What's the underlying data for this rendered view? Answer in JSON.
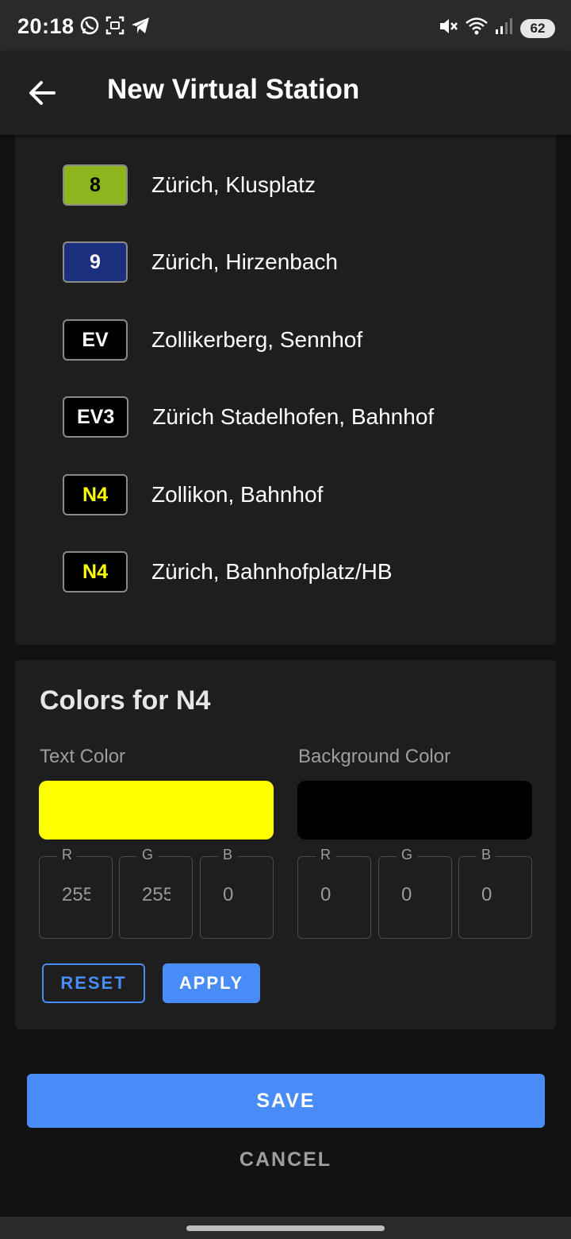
{
  "status_bar": {
    "time": "20:18",
    "battery": "62",
    "left_icons": [
      "whatsapp-icon",
      "screenshot-icon",
      "telegram-icon"
    ],
    "right_icons": [
      "mute-icon",
      "wifi-icon",
      "signal-icon",
      "battery-icon"
    ]
  },
  "app_bar": {
    "title": "New Virtual Station",
    "back_icon": "arrow-left-icon"
  },
  "stations": [
    {
      "line": "8",
      "name": "Zürich, Klusplatz",
      "text_color": "#000000",
      "bg_color": "#8db51e"
    },
    {
      "line": "9",
      "name": "Zürich, Hirzenbach",
      "text_color": "#ffffff",
      "bg_color": "#1a2f7e"
    },
    {
      "line": "EV",
      "name": "Zollikerberg, Sennhof",
      "text_color": "#ffffff",
      "bg_color": "#000000"
    },
    {
      "line": "EV3",
      "name": "Zürich Stadelhofen, Bahnhof",
      "text_color": "#ffffff",
      "bg_color": "#000000"
    },
    {
      "line": "N4",
      "name": "Zollikon, Bahnhof",
      "text_color": "#ffff00",
      "bg_color": "#000000"
    },
    {
      "line": "N4",
      "name": "Zürich, Bahnhofplatz/HB",
      "text_color": "#ffff00",
      "bg_color": "#000000"
    }
  ],
  "colors_panel": {
    "title": "Colors for N4",
    "text_color_label": "Text Color",
    "background_color_label": "Background Color",
    "text_color_swatch": "#ffff00",
    "background_color_swatch": "#000000",
    "text_rgb": [
      {
        "label": "R",
        "value": "255"
      },
      {
        "label": "G",
        "value": "255"
      },
      {
        "label": "B",
        "value": "0"
      }
    ],
    "background_rgb": [
      {
        "label": "R",
        "value": "0"
      },
      {
        "label": "G",
        "value": "0"
      },
      {
        "label": "B",
        "value": "0"
      }
    ],
    "reset_label": "RESET",
    "apply_label": "APPLY"
  },
  "actions": {
    "save_label": "SAVE",
    "cancel_label": "CANCEL"
  },
  "theme": {
    "accent": "#4a8cf7",
    "surface": "#1e1e1e",
    "background": "#121212"
  }
}
